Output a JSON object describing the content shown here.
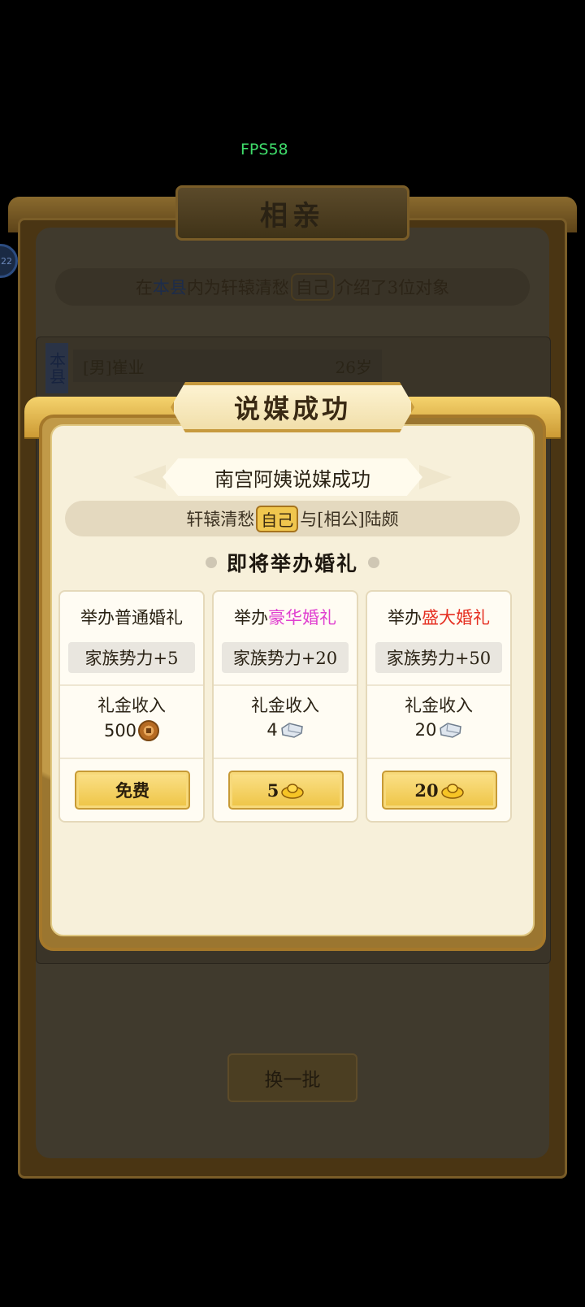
{
  "fps": "FPS58",
  "avatar_badge": "22",
  "background": {
    "title": "相亲",
    "info": {
      "prefix": "在",
      "region": "本县",
      "mid": "内为轩辕清愁",
      "self": "自己",
      "suffix": "介绍了3位对象"
    },
    "tag": "本县",
    "candidate": {
      "name": "[男]崔业",
      "age": "26岁"
    },
    "refresh_label": "换一批"
  },
  "dialog": {
    "title": "说媒成功",
    "subtitle": "南宫阿姨说媒成功",
    "pair": {
      "left": "轩辕清愁",
      "self": "自己",
      "right": "与[相公]陆颇"
    },
    "soon": "即将举办婚礼",
    "options": [
      {
        "prefix": "举办",
        "type": "普通婚礼",
        "type_color": "#2a2214",
        "power": "家族势力+5",
        "money_label": "礼金收入",
        "money_value": "500",
        "money_icon": "copper-coin-icon",
        "button": "免费",
        "button_icon": ""
      },
      {
        "prefix": "举办",
        "type": "豪华婚礼",
        "type_color": "#e040d0",
        "power": "家族势力+20",
        "money_label": "礼金收入",
        "money_value": "4",
        "money_icon": "silver-ingot-icon",
        "button": "5",
        "button_icon": "gold-ingot-icon"
      },
      {
        "prefix": "举办",
        "type": "盛大婚礼",
        "type_color": "#e53022",
        "power": "家族势力+50",
        "money_label": "礼金收入",
        "money_value": "20",
        "money_icon": "silver-ingot-icon",
        "button": "20",
        "button_icon": "gold-ingot-icon"
      }
    ]
  }
}
